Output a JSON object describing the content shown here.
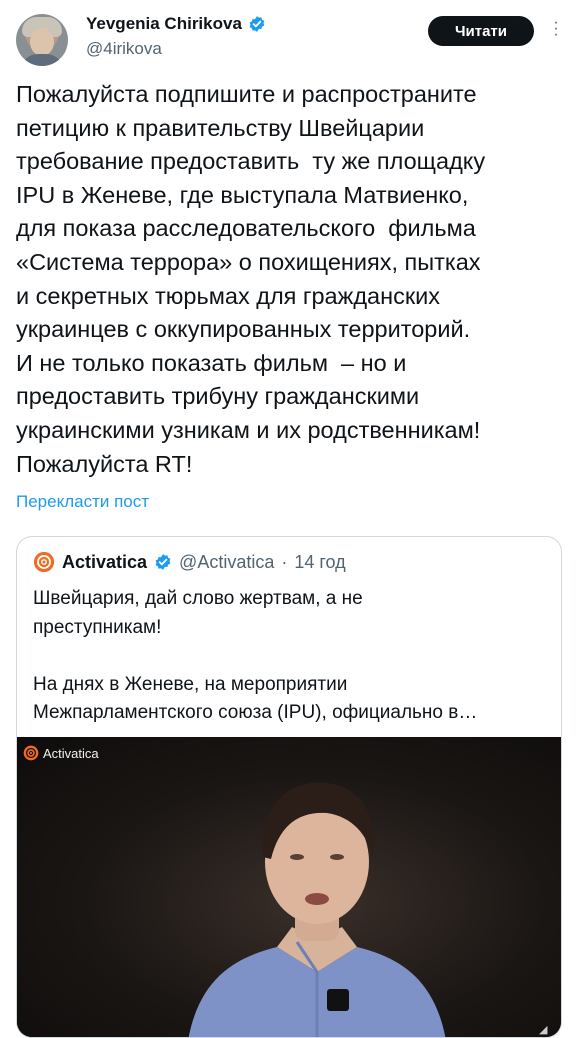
{
  "author": {
    "name": "Yevgenia Chirikova",
    "handle": "@4irikova"
  },
  "follow_label": "Читати",
  "tweet": {
    "text": "Пожалуйста подпишите и распространите\nпетицию к правительству Швейцарии\nтребование предоставить  ту же площадку\nIPU в Женеве, где выступала Матвиенко,\nдля показа расследовательского  фильма\n«Система террора» о похищениях, пытках\nи секретных тюрьмах для гражданских\nукраинцев с оккупированных территорий.\nИ не только показать фильм  – но и\nпредоставить трибуну гражданскими\nукраинскими узникам и их родственникам!\nПожалуйста RT!",
    "translate_label": "Перекласти пост"
  },
  "quote": {
    "name": "Activatica",
    "handle": "@Activatica",
    "separator": "·",
    "time": "14 год",
    "text": "Швейцария, дай слово жертвам, а не\nпреступникам!\n\nНа днях в Женеве, на мероприятии\nМежпарламентского союза (IPU), официально в…",
    "video": {
      "watermark": "Activatica"
    }
  },
  "colors": {
    "accent": "#1d9bf0",
    "verified": "#1d9bf0",
    "activatica_orange": "#f26b21"
  },
  "icons": {
    "verified": "verified-badge-icon",
    "more": "more-vertical-icon",
    "logo": "activatica-logo-icon"
  }
}
